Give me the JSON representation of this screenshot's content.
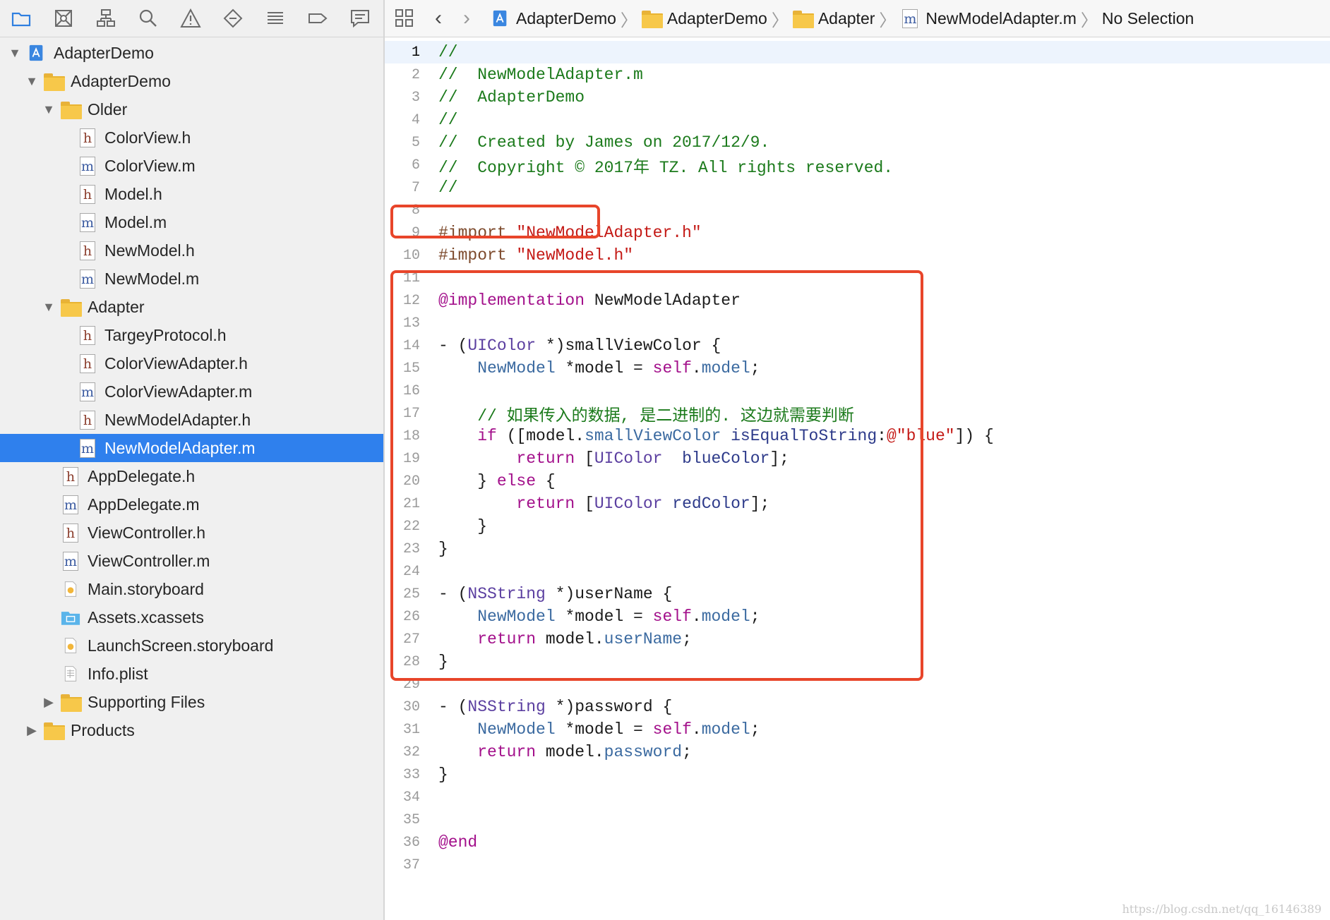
{
  "toolbar_icons": [
    "folder-icon",
    "source-control-icon",
    "hierarchy-icon",
    "search-icon",
    "warning-icon",
    "breakpoint-icon",
    "list-icon",
    "tag-icon",
    "message-icon"
  ],
  "tree": [
    {
      "label": "AdapterDemo",
      "kind": "project",
      "level": 0,
      "disclosure": "open"
    },
    {
      "label": "AdapterDemo",
      "kind": "folder",
      "level": 1,
      "disclosure": "open"
    },
    {
      "label": "Older",
      "kind": "folder",
      "level": 2,
      "disclosure": "open"
    },
    {
      "label": "ColorView.h",
      "kind": "h",
      "level": 3
    },
    {
      "label": "ColorView.m",
      "kind": "m",
      "level": 3
    },
    {
      "label": "Model.h",
      "kind": "h",
      "level": 3
    },
    {
      "label": "Model.m",
      "kind": "m",
      "level": 3
    },
    {
      "label": "NewModel.h",
      "kind": "h",
      "level": 3
    },
    {
      "label": "NewModel.m",
      "kind": "m",
      "level": 3
    },
    {
      "label": "Adapter",
      "kind": "folder",
      "level": 2,
      "disclosure": "open"
    },
    {
      "label": "TargeyProtocol.h",
      "kind": "h",
      "level": 3
    },
    {
      "label": "ColorViewAdapter.h",
      "kind": "h",
      "level": 3
    },
    {
      "label": "ColorViewAdapter.m",
      "kind": "m",
      "level": 3
    },
    {
      "label": "NewModelAdapter.h",
      "kind": "h",
      "level": 3
    },
    {
      "label": "NewModelAdapter.m",
      "kind": "m",
      "level": 3,
      "selected": true
    },
    {
      "label": "AppDelegate.h",
      "kind": "h",
      "level": 2
    },
    {
      "label": "AppDelegate.m",
      "kind": "m",
      "level": 2
    },
    {
      "label": "ViewController.h",
      "kind": "h",
      "level": 2
    },
    {
      "label": "ViewController.m",
      "kind": "m",
      "level": 2
    },
    {
      "label": "Main.storyboard",
      "kind": "storyboard",
      "level": 2
    },
    {
      "label": "Assets.xcassets",
      "kind": "assets",
      "level": 2
    },
    {
      "label": "LaunchScreen.storyboard",
      "kind": "storyboard",
      "level": 2
    },
    {
      "label": "Info.plist",
      "kind": "plist",
      "level": 2
    },
    {
      "label": "Supporting Files",
      "kind": "folder",
      "level": 2,
      "disclosure": "closed"
    },
    {
      "label": "Products",
      "kind": "folder",
      "level": 1,
      "disclosure": "closed"
    }
  ],
  "jumpbar": {
    "crumbs": [
      {
        "label": "AdapterDemo",
        "kind": "project"
      },
      {
        "label": "AdapterDemo",
        "kind": "folder"
      },
      {
        "label": "Adapter",
        "kind": "folder"
      },
      {
        "label": "NewModelAdapter.m",
        "kind": "m"
      },
      {
        "label": "No Selection",
        "kind": "none"
      }
    ]
  },
  "code": [
    [
      [
        "c-comment",
        "//"
      ]
    ],
    [
      [
        "c-comment",
        "//  NewModelAdapter.m"
      ]
    ],
    [
      [
        "c-comment",
        "//  AdapterDemo"
      ]
    ],
    [
      [
        "c-comment",
        "//"
      ]
    ],
    [
      [
        "c-comment",
        "//  Created by James on 2017/12/9."
      ]
    ],
    [
      [
        "c-comment",
        "//  Copyright © 2017年 TZ. All rights reserved."
      ]
    ],
    [
      [
        "c-comment",
        "//"
      ]
    ],
    [],
    [
      [
        "c-pre",
        "#import "
      ],
      [
        "c-str",
        "\"NewModelAdapter.h\""
      ]
    ],
    [
      [
        "c-pre",
        "#import "
      ],
      [
        "c-str",
        "\"NewModel.h\""
      ]
    ],
    [],
    [
      [
        "c-kw",
        "@implementation"
      ],
      [
        "c-plain",
        " NewModelAdapter"
      ]
    ],
    [],
    [
      [
        "c-plain",
        "- ("
      ],
      [
        "c-type",
        "UIColor"
      ],
      [
        "c-plain",
        " *)smallViewColor {"
      ]
    ],
    [
      [
        "c-plain",
        "    "
      ],
      [
        "c-prop",
        "NewModel"
      ],
      [
        "c-plain",
        " *model = "
      ],
      [
        "c-kw",
        "self"
      ],
      [
        "c-plain",
        "."
      ],
      [
        "c-prop",
        "model"
      ],
      [
        "c-plain",
        ";"
      ]
    ],
    [],
    [
      [
        "c-plain",
        "    "
      ],
      [
        "c-comment",
        "// 如果传入的数据, 是二进制的. 这边就需要判断"
      ]
    ],
    [
      [
        "c-plain",
        "    "
      ],
      [
        "c-kw",
        "if"
      ],
      [
        "c-plain",
        " ([model."
      ],
      [
        "c-prop",
        "smallViewColor"
      ],
      [
        "c-plain",
        " "
      ],
      [
        "c-meth",
        "isEqualToString"
      ],
      [
        "c-plain",
        ":"
      ],
      [
        "c-str",
        "@\"blue\""
      ],
      [
        "c-plain",
        "]) {"
      ]
    ],
    [
      [
        "c-plain",
        "        "
      ],
      [
        "c-kw",
        "return"
      ],
      [
        "c-plain",
        " ["
      ],
      [
        "c-type",
        "UIColor"
      ],
      [
        "c-plain",
        "  "
      ],
      [
        "c-meth",
        "blueColor"
      ],
      [
        "c-plain",
        "];"
      ]
    ],
    [
      [
        "c-plain",
        "    } "
      ],
      [
        "c-kw",
        "else"
      ],
      [
        "c-plain",
        " {"
      ]
    ],
    [
      [
        "c-plain",
        "        "
      ],
      [
        "c-kw",
        "return"
      ],
      [
        "c-plain",
        " ["
      ],
      [
        "c-type",
        "UIColor"
      ],
      [
        "c-plain",
        " "
      ],
      [
        "c-meth",
        "redColor"
      ],
      [
        "c-plain",
        "];"
      ]
    ],
    [
      [
        "c-plain",
        "    }"
      ]
    ],
    [
      [
        "c-plain",
        "}"
      ]
    ],
    [],
    [
      [
        "c-plain",
        "- ("
      ],
      [
        "c-type",
        "NSString"
      ],
      [
        "c-plain",
        " *)userName {"
      ]
    ],
    [
      [
        "c-plain",
        "    "
      ],
      [
        "c-prop",
        "NewModel"
      ],
      [
        "c-plain",
        " *model = "
      ],
      [
        "c-kw",
        "self"
      ],
      [
        "c-plain",
        "."
      ],
      [
        "c-prop",
        "model"
      ],
      [
        "c-plain",
        ";"
      ]
    ],
    [
      [
        "c-plain",
        "    "
      ],
      [
        "c-kw",
        "return"
      ],
      [
        "c-plain",
        " model."
      ],
      [
        "c-prop",
        "userName"
      ],
      [
        "c-plain",
        ";"
      ]
    ],
    [
      [
        "c-plain",
        "}"
      ]
    ],
    [],
    [
      [
        "c-plain",
        "- ("
      ],
      [
        "c-type",
        "NSString"
      ],
      [
        "c-plain",
        " *)password {"
      ]
    ],
    [
      [
        "c-plain",
        "    "
      ],
      [
        "c-prop",
        "NewModel"
      ],
      [
        "c-plain",
        " *model = "
      ],
      [
        "c-kw",
        "self"
      ],
      [
        "c-plain",
        "."
      ],
      [
        "c-prop",
        "model"
      ],
      [
        "c-plain",
        ";"
      ]
    ],
    [
      [
        "c-plain",
        "    "
      ],
      [
        "c-kw",
        "return"
      ],
      [
        "c-plain",
        " model."
      ],
      [
        "c-prop",
        "password"
      ],
      [
        "c-plain",
        ";"
      ]
    ],
    [
      [
        "c-plain",
        "}"
      ]
    ],
    [],
    [],
    [
      [
        "c-kw",
        "@end"
      ]
    ],
    []
  ],
  "current_line": 1,
  "watermark": "https://blog.csdn.net/qq_16146389",
  "colors": {
    "selection": "#2f80ed",
    "highlight_box": "#e8452a",
    "current_line": "#edf4fd"
  }
}
